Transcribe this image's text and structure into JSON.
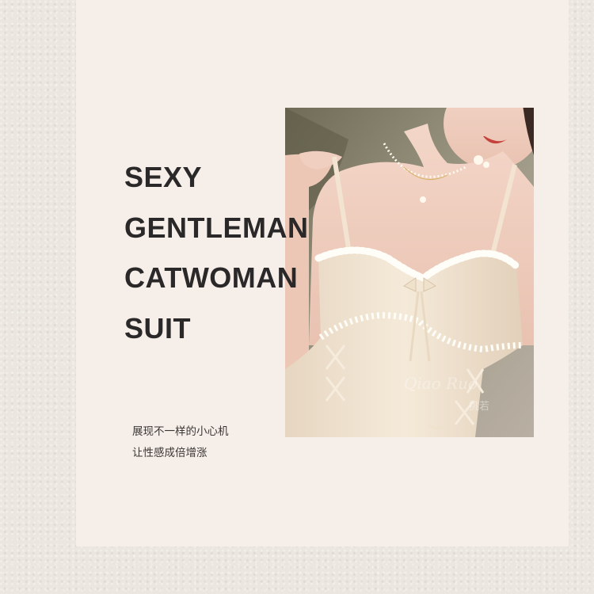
{
  "headline": {
    "line1": "SEXY",
    "line2": "GENTLEMAN",
    "line3": "CATWOMAN",
    "line4": "SUIT"
  },
  "tagline": {
    "line1": "展现不一样的小心机",
    "line2": "让性感成倍增涨"
  },
  "photo": {
    "watermark": "Qiao Ruo 挑若",
    "subject": "model wearing cream lace-trimmed camisole dress with pearl necklace"
  },
  "colors": {
    "background": "#ebe6df",
    "panel": "#f6efe9",
    "headline_text": "#2a2828",
    "dress": "#efe2cf"
  }
}
